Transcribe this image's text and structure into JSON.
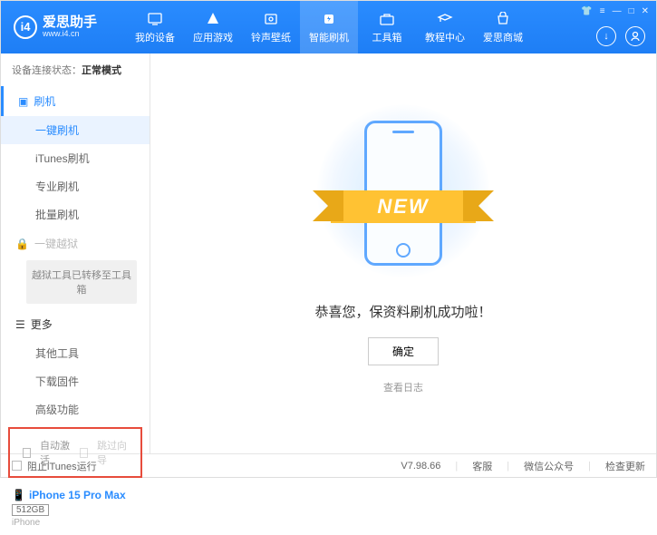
{
  "header": {
    "title": "爱思助手",
    "url": "www.i4.cn",
    "nav": [
      {
        "label": "我的设备",
        "icon": "device"
      },
      {
        "label": "应用游戏",
        "icon": "apps"
      },
      {
        "label": "铃声壁纸",
        "icon": "ringtone"
      },
      {
        "label": "智能刷机",
        "icon": "flash"
      },
      {
        "label": "工具箱",
        "icon": "toolbox"
      },
      {
        "label": "教程中心",
        "icon": "tutorial"
      },
      {
        "label": "爱思商城",
        "icon": "shop"
      }
    ]
  },
  "status": {
    "label": "设备连接状态：",
    "value": "正常模式"
  },
  "sidebar": {
    "flash_section": "刷机",
    "items": [
      "一键刷机",
      "iTunes刷机",
      "专业刷机",
      "批量刷机"
    ],
    "jailbreak": "一键越狱",
    "jailbreak_note": "越狱工具已转移至工具箱",
    "more_section": "更多",
    "more_items": [
      "其他工具",
      "下载固件",
      "高级功能"
    ],
    "checkbox1": "自动激活",
    "checkbox2": "跳过向导"
  },
  "device": {
    "name": "iPhone 15 Pro Max",
    "storage": "512GB",
    "type": "iPhone"
  },
  "main": {
    "ribbon": "NEW",
    "message": "恭喜您，保资料刷机成功啦！",
    "ok": "确定",
    "log": "查看日志"
  },
  "footer": {
    "block_itunes": "阻止iTunes运行",
    "version": "V7.98.66",
    "links": [
      "客服",
      "微信公众号",
      "检查更新"
    ]
  }
}
